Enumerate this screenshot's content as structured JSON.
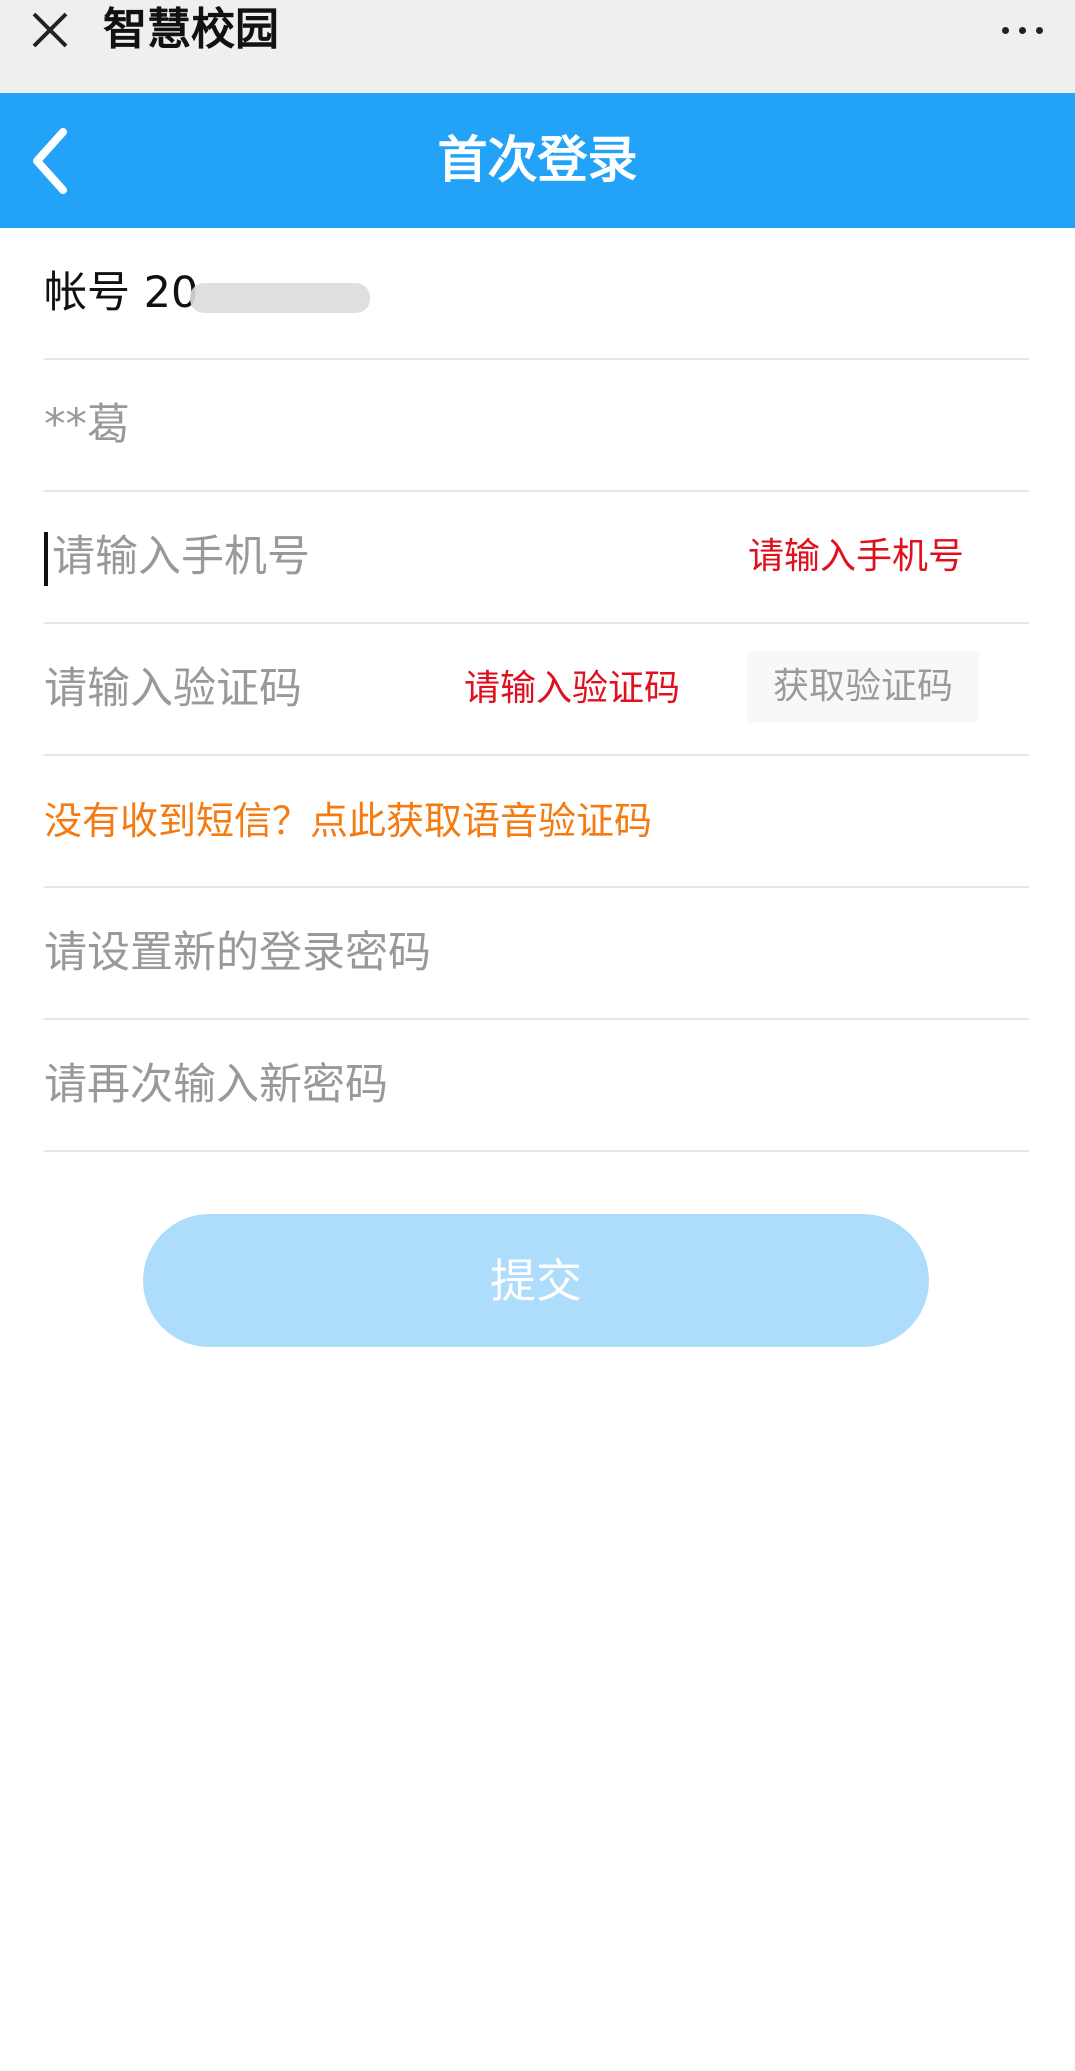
{
  "topbar": {
    "app_title": "智慧校园"
  },
  "header": {
    "title": "首次登录"
  },
  "form": {
    "account_label": "帐号 20",
    "name_value": "**葛",
    "phone_placeholder": "请输入手机号",
    "phone_error": "请输入手机号",
    "code_placeholder": "请输入验证码",
    "code_error": "请输入验证码",
    "get_code_button": "获取验证码",
    "voice_code_link": "没有收到短信？点此获取语音验证码",
    "new_password_placeholder": "请设置新的登录密码",
    "confirm_password_placeholder": "请再次输入新密码"
  },
  "submit_label": "提交",
  "colors": {
    "header_blue": "#22a3f8",
    "error_red": "#e0101e",
    "link_orange": "#f57a10",
    "submit_disabled": "#aedcfb"
  },
  "icons": {
    "close": "close-icon",
    "more": "more-dots-icon",
    "back": "chevron-left-icon"
  }
}
